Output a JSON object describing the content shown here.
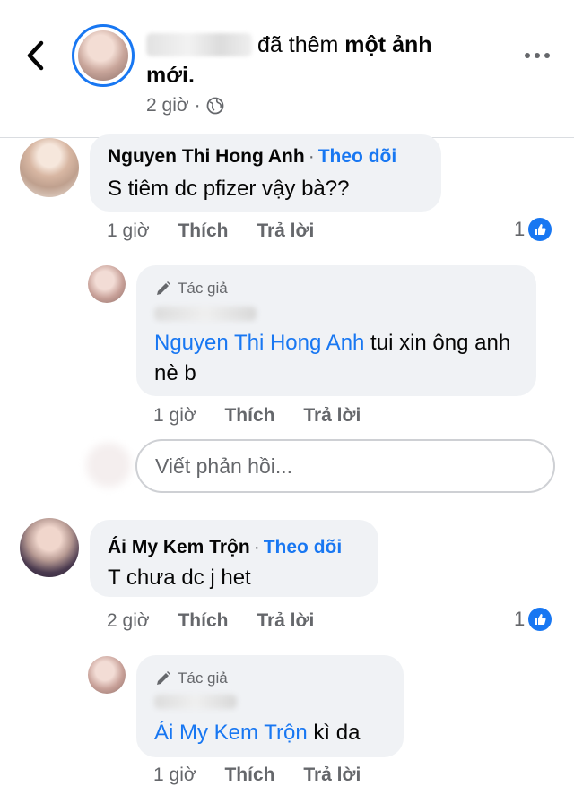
{
  "post_header": {
    "action_text": "đã thêm",
    "bold_text": "một ảnh",
    "line2": "mới.",
    "time": "2 giờ",
    "dot": "·"
  },
  "comments": [
    {
      "name": "Nguyen Thi Hong Anh",
      "follow": "Theo dõi",
      "text": "S tiêm dc pfizer vậy bà??",
      "time": "1 giờ",
      "like": "Thích",
      "reply": "Trả lời",
      "reactions": "1",
      "replies": [
        {
          "badge": "Tác giả",
          "mention": "Nguyen Thi Hong Anh",
          "text": " tui xin ông anh nè b",
          "time": "1 giờ",
          "like": "Thích",
          "reply": "Trả lời"
        }
      ]
    },
    {
      "name": "Ái My Kem Trộn",
      "follow": "Theo dõi",
      "text": "T chưa dc j het",
      "time": "2 giờ",
      "like": "Thích",
      "reply": "Trả lời",
      "reactions": "1",
      "replies": [
        {
          "badge": "Tác giả",
          "mention": "Ái My Kem Trộn",
          "text": " kì da",
          "time": "1 giờ",
          "like": "Thích",
          "reply": "Trả lời"
        }
      ]
    }
  ],
  "reply_box": {
    "placeholder": "Viết phản hồi..."
  },
  "colors": {
    "accent": "#1877f2",
    "bubble": "#f0f2f5",
    "secondary_text": "#65676b"
  },
  "icons": {
    "back": "back-arrow-icon",
    "more": "more-dots-icon",
    "globe": "globe-icon",
    "like": "like-thumb-icon",
    "author": "pencil-icon"
  }
}
